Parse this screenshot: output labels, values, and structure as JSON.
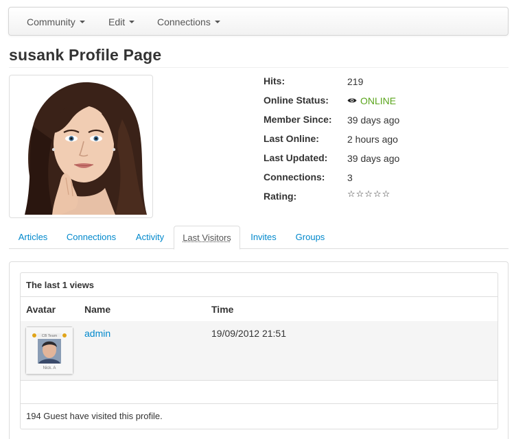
{
  "navbar": {
    "items": [
      {
        "label": "Community"
      },
      {
        "label": "Edit"
      },
      {
        "label": "Connections"
      }
    ]
  },
  "profile": {
    "title": "susank Profile Page",
    "photo_icon": "profile-photo",
    "info": {
      "hits_label": "Hits:",
      "hits_value": "219",
      "status_label": "Online Status:",
      "status_value": "ONLINE",
      "status_color": "#5aa51c",
      "member_since_label": "Member Since:",
      "member_since_value": "39 days ago",
      "last_online_label": "Last Online:",
      "last_online_value": "2 hours ago",
      "last_updated_label": "Last Updated:",
      "last_updated_value": "39 days ago",
      "connections_label": "Connections:",
      "connections_value": "3",
      "rating_label": "Rating:",
      "rating_value": "☆☆☆☆☆"
    }
  },
  "tabs": {
    "items": [
      {
        "label": "Articles"
      },
      {
        "label": "Connections"
      },
      {
        "label": "Activity"
      },
      {
        "label": "Last Visitors"
      },
      {
        "label": "Invites"
      },
      {
        "label": "Groups"
      }
    ],
    "active": "Last Visitors"
  },
  "visitors": {
    "heading": "The last 1 views",
    "columns": {
      "avatar": "Avatar",
      "name": "Name",
      "time": "Time"
    },
    "rows": [
      {
        "name": "admin",
        "time": "19/09/2012 21:51",
        "avatar_caption": "Nick. A",
        "avatar_banner": "CB Team"
      }
    ],
    "guest_summary": "194 Guest have visited this profile."
  },
  "colors": {
    "link": "#0088cc",
    "online": "#5aa51c",
    "border": "#dddddd"
  }
}
